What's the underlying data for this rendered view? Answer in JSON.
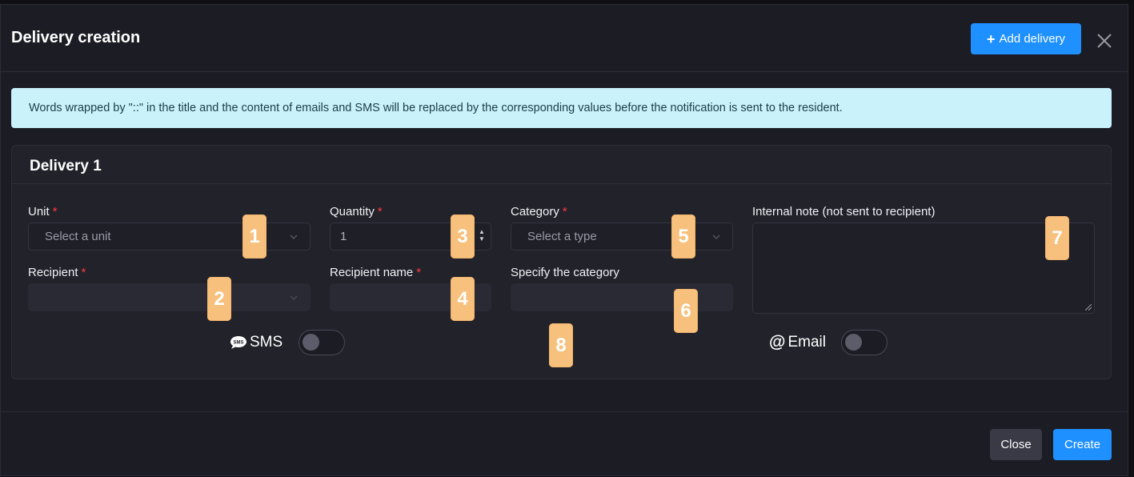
{
  "modal": {
    "title": "Delivery creation",
    "add_delivery_label": "Add delivery",
    "add_delivery_icon": "plus-icon",
    "close_icon": "close-icon"
  },
  "info_banner": {
    "text": "Words wrapped by \"::\" in the title and the content of emails and SMS will be replaced by the corresponding values before the notification is sent to the resident."
  },
  "delivery": {
    "title": "Delivery 1",
    "unit": {
      "label": "Unit",
      "required": "*",
      "placeholder": "Select a unit"
    },
    "quantity": {
      "label": "Quantity",
      "required": "*",
      "value": "1"
    },
    "category": {
      "label": "Category",
      "required": "*",
      "placeholder": "Select a type"
    },
    "internal_note": {
      "label": "Internal note (not sent to recipient)",
      "value": ""
    },
    "recipient": {
      "label": "Recipient",
      "required": "*",
      "value": ""
    },
    "recipient_name": {
      "label": "Recipient name",
      "required": "*",
      "value": ""
    },
    "specify_category": {
      "label": "Specify the category",
      "value": ""
    },
    "sms": {
      "label": "SMS",
      "icon": "sms-icon",
      "enabled": false
    },
    "email": {
      "label": "Email",
      "icon": "at-icon",
      "enabled": false
    }
  },
  "annotations": [
    "1",
    "2",
    "3",
    "4",
    "5",
    "6",
    "7",
    "8"
  ],
  "footer": {
    "close_label": "Close",
    "create_label": "Create"
  },
  "colors": {
    "accent": "#1e90ff",
    "banner": "#c9f2fa",
    "required": "#ff3b3b",
    "annotation": "#f7c07c",
    "background": "#1c1c24"
  }
}
